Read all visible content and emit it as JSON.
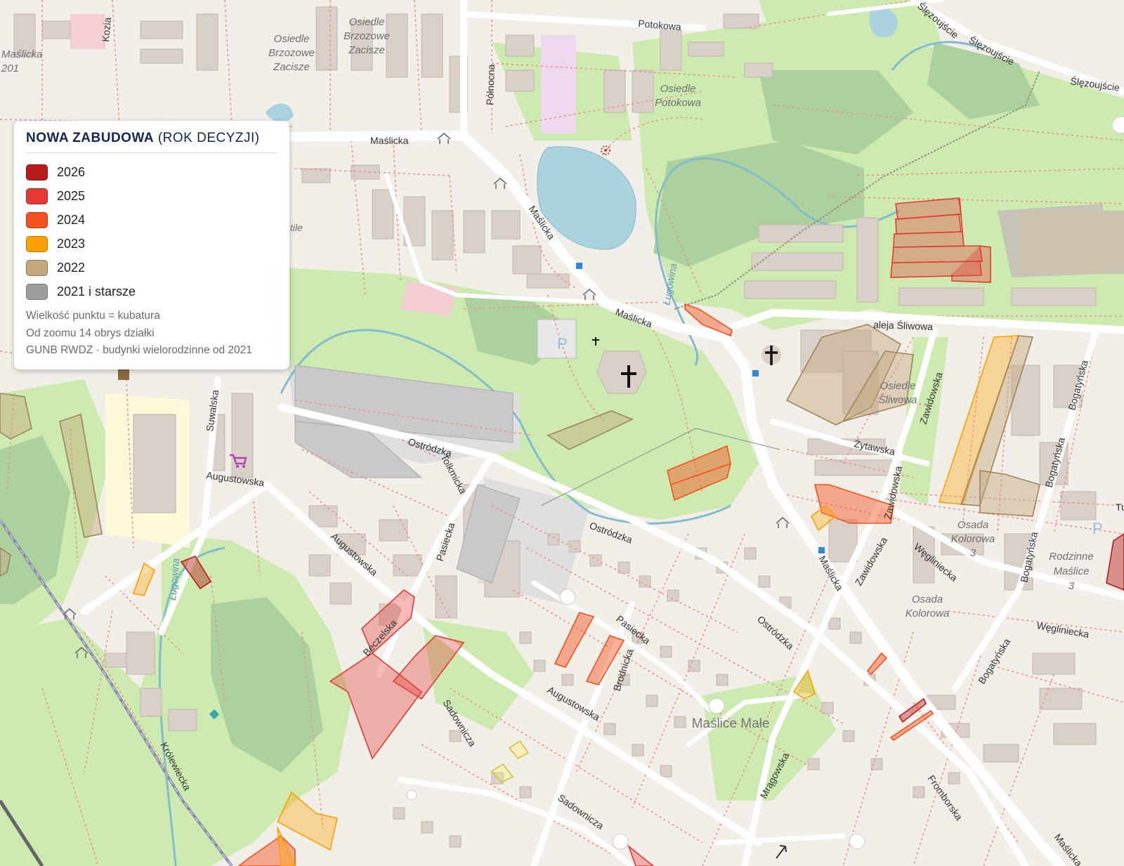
{
  "legend": {
    "title_bold": "NOWA ZABUDOWA",
    "title_rest": "(ROK DECYZJI)",
    "items": [
      {
        "label": "2026",
        "color": "#b71c1c"
      },
      {
        "label": "2025",
        "color": "#e53935"
      },
      {
        "label": "2024",
        "color": "#f4511e"
      },
      {
        "label": "2023",
        "color": "#ffa000"
      },
      {
        "label": "2022",
        "color": "#c4a77c"
      },
      {
        "label": "2021 i starsze",
        "color": "#9e9e9e"
      }
    ],
    "notes": [
      "Wielkość punktu = kubatura",
      "Od zoomu 14 obrys działki",
      "GUNB RWDZ · budynki wielorodzinne od 2021"
    ]
  },
  "map": {
    "streets": [
      "Maślicka",
      "Potokowa",
      "Ślęzoujście",
      "Północna",
      "Kozia",
      "aleja Śliwowa",
      "Zawidowska",
      "Bogatyńska",
      "Żytawska",
      "Ostródzka",
      "Augustowska",
      "Suwalska",
      "Tolkmicka",
      "Pasiecka",
      "Brodnicka",
      "Beczelska",
      "Sadownicza",
      "Mrągowska",
      "Fromborska",
      "Węgliniecka",
      "Królewiecka",
      "Ługowina",
      "Tu"
    ],
    "areas": [
      "Osiedle Brzozowe Zacisze",
      "Osiedle Potokowa",
      "Osiedle Śliwowa",
      "Osada Kolorowa 3",
      "Osada Kolorowa",
      "Rodzinne Maślice 3",
      "Maślice Małe",
      "Maślicka 201"
    ],
    "map_text": [
      "P",
      "tile"
    ]
  }
}
